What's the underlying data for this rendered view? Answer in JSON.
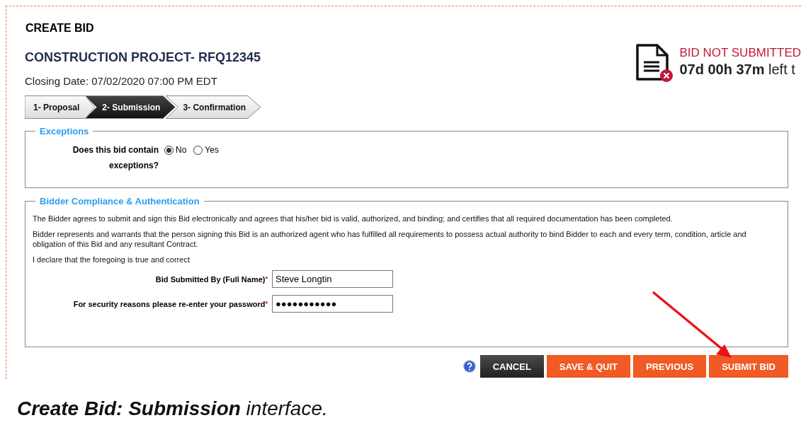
{
  "page_title": "CREATE BID",
  "project_title": "CONSTRUCTION PROJECT- RFQ12345",
  "closing": {
    "label": "Closing Date:",
    "value": "07/02/2020 07:00 PM EDT"
  },
  "status": {
    "title": "BID NOT SUBMITTED",
    "countdown": "**07d 00h 37m** left t"
  },
  "steps": [
    {
      "label": "1- Proposal",
      "selected": false
    },
    {
      "label": "2- Submission",
      "selected": true
    },
    {
      "label": "3- Confirmation",
      "selected": false
    }
  ],
  "exceptions": {
    "legend": "Exceptions",
    "question": "Does this bid contain exceptions?",
    "options": [
      {
        "label": "No",
        "selected": true
      },
      {
        "label": "Yes",
        "selected": false
      }
    ]
  },
  "compliance": {
    "legend": "Bidder Compliance & Authentication",
    "paragraphs": [
      "The Bidder agrees to submit and sign this Bid electronically and agrees that his/her bid is valid, authorized, and binding; and certifies that all required documentation has been completed.",
      "Bidder represents and warrants that the person signing this Bid is an authorized agent who has fulfilled all requirements to possess actual authority to bind Bidder to each and every term, condition, article and obligation of this Bid and any resultant Contract.",
      "I declare that the foregoing is true and correct"
    ],
    "fields": [
      {
        "label": "Bid Submitted By (Full Name)",
        "required": "*",
        "value": "Steve Longtin"
      },
      {
        "label": "For security reasons please re-enter your password",
        "required": "*",
        "value": "●●●●●●●●●●●"
      }
    ]
  },
  "buttons": [
    {
      "label": "CANCEL",
      "kind": "dark"
    },
    {
      "label": "SAVE & QUIT",
      "kind": "accent"
    },
    {
      "label": "PREVIOUS",
      "kind": "accent"
    },
    {
      "label": "SUBMIT BID",
      "kind": "accent"
    }
  ],
  "caption": "**Create Bid: Submission** interface."
}
